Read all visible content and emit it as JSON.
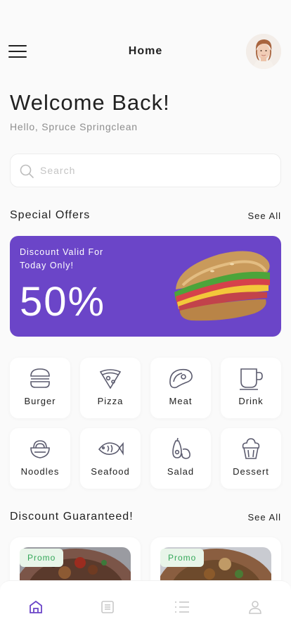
{
  "header": {
    "title": "Home"
  },
  "welcome": {
    "title": "Welcome Back!",
    "subtitle": "Hello, Spruce Springclean"
  },
  "search": {
    "placeholder": "Search",
    "value": ""
  },
  "special_offers": {
    "title": "Special Offers",
    "see_all": "See All",
    "banner": {
      "note": "Discount Valid For Today Only!",
      "percent": "50%",
      "background": "#6b45c8"
    }
  },
  "categories": [
    {
      "label": "Burger",
      "icon": "burger-icon"
    },
    {
      "label": "Pizza",
      "icon": "pizza-icon"
    },
    {
      "label": "Meat",
      "icon": "meat-icon"
    },
    {
      "label": "Drink",
      "icon": "drink-icon"
    },
    {
      "label": "Noodles",
      "icon": "noodles-icon"
    },
    {
      "label": "Seafood",
      "icon": "fish-icon"
    },
    {
      "label": "Salad",
      "icon": "salad-icon"
    },
    {
      "label": "Dessert",
      "icon": "dessert-icon"
    }
  ],
  "discount": {
    "title": "Discount Guaranteed!",
    "see_all": "See All",
    "cards": [
      {
        "badge": "Promo"
      },
      {
        "badge": "Promo"
      }
    ]
  },
  "bottom_nav": [
    {
      "icon": "home-icon",
      "active": true
    },
    {
      "icon": "orders-icon",
      "active": false
    },
    {
      "icon": "list-icon",
      "active": false
    },
    {
      "icon": "profile-icon",
      "active": false
    }
  ],
  "colors": {
    "accent": "#6b45c8",
    "promo_text": "#35a85a",
    "promo_bg": "#e8f5e9"
  }
}
